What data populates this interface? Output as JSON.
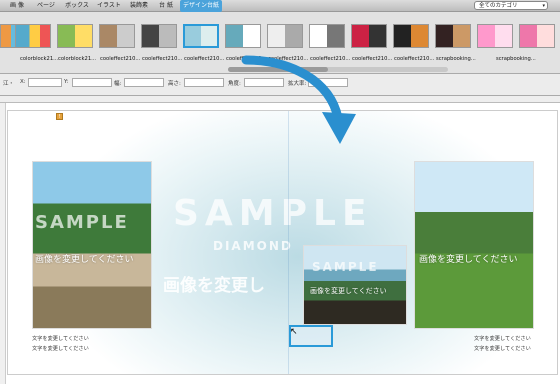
{
  "tabs": [
    "画 像",
    "ページ",
    "ボックス",
    "イラスト",
    "装飾素",
    "台 紙",
    "デザイン台紙"
  ],
  "active_tab": "デザイン台紙",
  "category": "全てのカテゴリ",
  "thumbnails": [
    "colorblock21...",
    "colorblock21...",
    "cooleffect210...",
    "cooleffect210...",
    "cooleffect210...",
    "cooleffect210...",
    "cooleffect210...",
    "cooleffect210...",
    "cooleffect210...",
    "cooleffect210...",
    "scrapbooking...",
    "scrapbooking..."
  ],
  "propbar": {
    "x_label": "X:",
    "y_label": "Y:",
    "w_label": "幅:",
    "h_label": "高さ:",
    "angle_label": "角度:",
    "zoom_label": "拡大率:",
    "left_icon": "江・"
  },
  "page_badge": "!",
  "bg_sample": "SAMPLE",
  "bg_diamond": "DIAMOND",
  "photos": {
    "left": {
      "sample": "SAMPLE",
      "change": "画像を変更してください"
    },
    "mid": {
      "sample": "SAMPLE",
      "change": "画像を変更してください"
    },
    "right": {
      "change": "画像を変更してください"
    }
  },
  "center_change": "画像を変更し",
  "captions": {
    "left1": "文字を変更してください",
    "left2": "文字を変更してください",
    "right1": "文字を変更してください",
    "right2": "文字を変更してください"
  }
}
